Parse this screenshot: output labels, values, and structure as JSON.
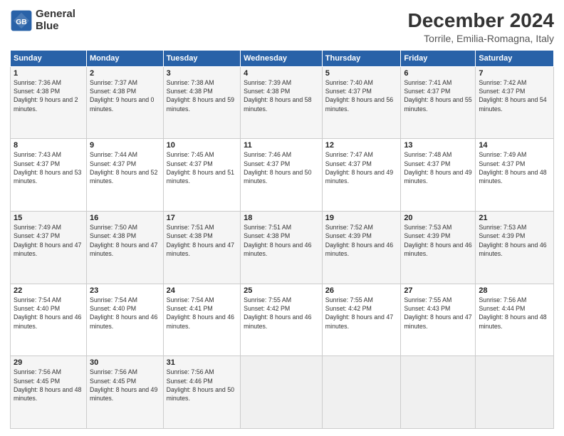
{
  "logo": {
    "line1": "General",
    "line2": "Blue"
  },
  "title": "December 2024",
  "subtitle": "Torrile, Emilia-Romagna, Italy",
  "columns": [
    "Sunday",
    "Monday",
    "Tuesday",
    "Wednesday",
    "Thursday",
    "Friday",
    "Saturday"
  ],
  "weeks": [
    [
      {
        "day": "1",
        "sunrise": "7:36 AM",
        "sunset": "4:38 PM",
        "daylight": "9 hours and 2 minutes."
      },
      {
        "day": "2",
        "sunrise": "7:37 AM",
        "sunset": "4:38 PM",
        "daylight": "9 hours and 0 minutes."
      },
      {
        "day": "3",
        "sunrise": "7:38 AM",
        "sunset": "4:38 PM",
        "daylight": "8 hours and 59 minutes."
      },
      {
        "day": "4",
        "sunrise": "7:39 AM",
        "sunset": "4:38 PM",
        "daylight": "8 hours and 58 minutes."
      },
      {
        "day": "5",
        "sunrise": "7:40 AM",
        "sunset": "4:37 PM",
        "daylight": "8 hours and 56 minutes."
      },
      {
        "day": "6",
        "sunrise": "7:41 AM",
        "sunset": "4:37 PM",
        "daylight": "8 hours and 55 minutes."
      },
      {
        "day": "7",
        "sunrise": "7:42 AM",
        "sunset": "4:37 PM",
        "daylight": "8 hours and 54 minutes."
      }
    ],
    [
      {
        "day": "8",
        "sunrise": "7:43 AM",
        "sunset": "4:37 PM",
        "daylight": "8 hours and 53 minutes."
      },
      {
        "day": "9",
        "sunrise": "7:44 AM",
        "sunset": "4:37 PM",
        "daylight": "8 hours and 52 minutes."
      },
      {
        "day": "10",
        "sunrise": "7:45 AM",
        "sunset": "4:37 PM",
        "daylight": "8 hours and 51 minutes."
      },
      {
        "day": "11",
        "sunrise": "7:46 AM",
        "sunset": "4:37 PM",
        "daylight": "8 hours and 50 minutes."
      },
      {
        "day": "12",
        "sunrise": "7:47 AM",
        "sunset": "4:37 PM",
        "daylight": "8 hours and 49 minutes."
      },
      {
        "day": "13",
        "sunrise": "7:48 AM",
        "sunset": "4:37 PM",
        "daylight": "8 hours and 49 minutes."
      },
      {
        "day": "14",
        "sunrise": "7:49 AM",
        "sunset": "4:37 PM",
        "daylight": "8 hours and 48 minutes."
      }
    ],
    [
      {
        "day": "15",
        "sunrise": "7:49 AM",
        "sunset": "4:37 PM",
        "daylight": "8 hours and 47 minutes."
      },
      {
        "day": "16",
        "sunrise": "7:50 AM",
        "sunset": "4:38 PM",
        "daylight": "8 hours and 47 minutes."
      },
      {
        "day": "17",
        "sunrise": "7:51 AM",
        "sunset": "4:38 PM",
        "daylight": "8 hours and 47 minutes."
      },
      {
        "day": "18",
        "sunrise": "7:51 AM",
        "sunset": "4:38 PM",
        "daylight": "8 hours and 46 minutes."
      },
      {
        "day": "19",
        "sunrise": "7:52 AM",
        "sunset": "4:39 PM",
        "daylight": "8 hours and 46 minutes."
      },
      {
        "day": "20",
        "sunrise": "7:53 AM",
        "sunset": "4:39 PM",
        "daylight": "8 hours and 46 minutes."
      },
      {
        "day": "21",
        "sunrise": "7:53 AM",
        "sunset": "4:39 PM",
        "daylight": "8 hours and 46 minutes."
      }
    ],
    [
      {
        "day": "22",
        "sunrise": "7:54 AM",
        "sunset": "4:40 PM",
        "daylight": "8 hours and 46 minutes."
      },
      {
        "day": "23",
        "sunrise": "7:54 AM",
        "sunset": "4:40 PM",
        "daylight": "8 hours and 46 minutes."
      },
      {
        "day": "24",
        "sunrise": "7:54 AM",
        "sunset": "4:41 PM",
        "daylight": "8 hours and 46 minutes."
      },
      {
        "day": "25",
        "sunrise": "7:55 AM",
        "sunset": "4:42 PM",
        "daylight": "8 hours and 46 minutes."
      },
      {
        "day": "26",
        "sunrise": "7:55 AM",
        "sunset": "4:42 PM",
        "daylight": "8 hours and 47 minutes."
      },
      {
        "day": "27",
        "sunrise": "7:55 AM",
        "sunset": "4:43 PM",
        "daylight": "8 hours and 47 minutes."
      },
      {
        "day": "28",
        "sunrise": "7:56 AM",
        "sunset": "4:44 PM",
        "daylight": "8 hours and 48 minutes."
      }
    ],
    [
      {
        "day": "29",
        "sunrise": "7:56 AM",
        "sunset": "4:45 PM",
        "daylight": "8 hours and 48 minutes."
      },
      {
        "day": "30",
        "sunrise": "7:56 AM",
        "sunset": "4:45 PM",
        "daylight": "8 hours and 49 minutes."
      },
      {
        "day": "31",
        "sunrise": "7:56 AM",
        "sunset": "4:46 PM",
        "daylight": "8 hours and 50 minutes."
      },
      null,
      null,
      null,
      null
    ]
  ]
}
